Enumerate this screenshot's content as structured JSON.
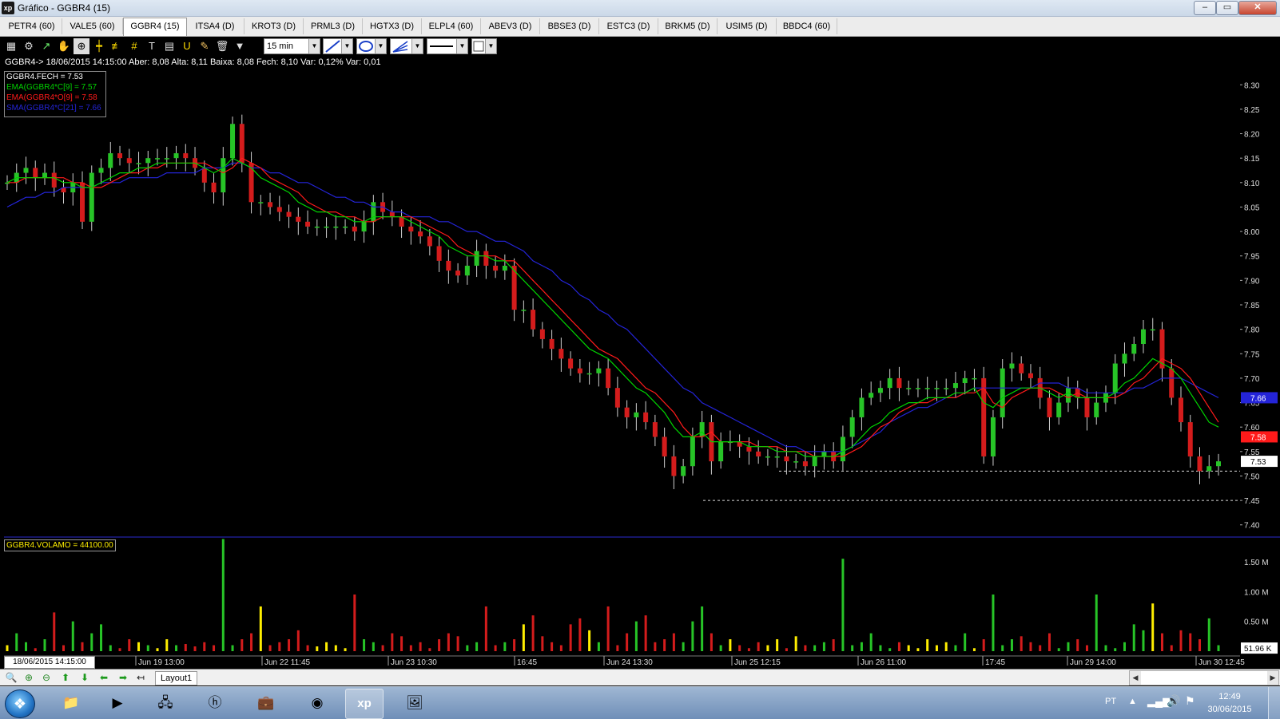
{
  "window": {
    "app_icon": "xp",
    "title": "Gráfico - GGBR4 (15)",
    "controls": [
      "–",
      "▭",
      "✕"
    ]
  },
  "tabs": [
    {
      "label": "PETR4 (60)"
    },
    {
      "label": "VALE5 (60)"
    },
    {
      "label": "GGBR4 (15)",
      "active": true
    },
    {
      "label": "ITSA4 (D)"
    },
    {
      "label": "KROT3 (D)"
    },
    {
      "label": "PRML3 (D)"
    },
    {
      "label": "HGTX3 (D)"
    },
    {
      "label": "ELPL4 (60)"
    },
    {
      "label": "ABEV3 (D)"
    },
    {
      "label": "BBSE3 (D)"
    },
    {
      "label": "ESTC3 (D)"
    },
    {
      "label": "BRKM5 (D)"
    },
    {
      "label": "USIM5 (D)"
    },
    {
      "label": "BBDC4 (60)"
    }
  ],
  "toolbar": {
    "icons": [
      "chart-icon",
      "gear-icon",
      "cursor-icon",
      "hand-icon",
      "zoom-box-icon",
      "crosshair-icon",
      "fibonacci-icon",
      "grid-icon",
      "text-icon",
      "calculator-icon",
      "magnet-icon",
      "brush-icon",
      "trash-icon",
      "filter-icon"
    ],
    "interval": "15 min"
  },
  "chart": {
    "info_line": "GGBR4-> 18/06/2015 14:15:00 Aber: 8,08 Alta: 8,11 Baixa: 8,08 Fech: 8,10 Var: 0,12% Var: 0,01",
    "legend": [
      {
        "label": "GGBR4.FECH = 7.53",
        "color": "#ffffff"
      },
      {
        "label": "EMA(GGBR4*C[9] = 7.57",
        "color": "#00d400"
      },
      {
        "label": "EMA(GGBR4*O[9] = 7.58",
        "color": "#ff1a1a"
      },
      {
        "label": "SMA(GGBR4*C[21] = 7.66",
        "color": "#2424d8"
      }
    ],
    "volume_label": "GGBR4.VOLAMO = 44100.00",
    "cursor_date": "18/06/2015 14:15:00",
    "x_labels": [
      "Jun 19 13:00",
      "Jun 22 11:45",
      "Jun 23 10:30",
      "16:45",
      "Jun 24 13:30",
      "Jun 25 12:15",
      "Jun 26 11:00",
      "17:45",
      "Jun 29 14:00",
      "Jun 30 12:45"
    ],
    "price_ticks": [
      "8.30",
      "8.25",
      "8.20",
      "8.15",
      "8.10",
      "8.05",
      "8.00",
      "7.95",
      "7.90",
      "7.85",
      "7.80",
      "7.75",
      "7.70",
      "7.65",
      "7.60",
      "7.55",
      "7.50",
      "7.45",
      "7.40"
    ],
    "volume_ticks": [
      "1.50 M",
      "1.00 M",
      "0.50 M"
    ],
    "price_tags": [
      {
        "label": "7.66",
        "value": 7.66,
        "color": "#2424d8"
      },
      {
        "label": "7.58",
        "value": 7.58,
        "color": "#ff1a1a"
      },
      {
        "label": "7.53",
        "value": 7.53,
        "color": "#ffffff"
      }
    ],
    "volume_tag": "51.96 K",
    "colors": {
      "up": "#27c427",
      "down": "#d41c1c",
      "ema9_close": "#00d400",
      "ema9_open": "#ff1a1a",
      "sma21": "#2424d8",
      "volume_doji": "#ffee00"
    }
  },
  "chart_data": {
    "type": "candlestick",
    "title": "GGBR4 (15)",
    "ylim": [
      7.38,
      8.32
    ],
    "price_levels": [
      7.51,
      7.45
    ],
    "series": [
      {
        "name": "GGBR4.FECH",
        "values": [
          8.1,
          8.12,
          8.13,
          8.11,
          8.12,
          8.09,
          8.08,
          8.1,
          8.02,
          8.12,
          8.13,
          8.16,
          8.15,
          8.14,
          8.14,
          8.15,
          8.15,
          8.15,
          8.16,
          8.15,
          8.13,
          8.1,
          8.08,
          8.15,
          8.22,
          8.14,
          8.06,
          8.06,
          8.05,
          8.04,
          8.03,
          8.02,
          8.01,
          8.01,
          8.01,
          8.01,
          8.01,
          8.0,
          8.02,
          8.06,
          8.04,
          8.03,
          8.01,
          8.0,
          7.99,
          7.97,
          7.94,
          7.92,
          7.91,
          7.93,
          7.96,
          7.93,
          7.92,
          7.93,
          7.84,
          7.84,
          7.8,
          7.78,
          7.76,
          7.74,
          7.72,
          7.71,
          7.71,
          7.72,
          7.68,
          7.64,
          7.62,
          7.63,
          7.61,
          7.58,
          7.54,
          7.5,
          7.52,
          7.58,
          7.61,
          7.53,
          7.57,
          7.57,
          7.56,
          7.55,
          7.54,
          7.54,
          7.54,
          7.53,
          7.53,
          7.52,
          7.54,
          7.55,
          7.53,
          7.58,
          7.62,
          7.66,
          7.67,
          7.68,
          7.7,
          7.68,
          7.68,
          7.68,
          7.68,
          7.68,
          7.68,
          7.69,
          7.7,
          7.7,
          7.54,
          7.62,
          7.72,
          7.73,
          7.71,
          7.7,
          7.66,
          7.62,
          7.65,
          7.68,
          7.66,
          7.62,
          7.65,
          7.67,
          7.73,
          7.75,
          7.77,
          7.8,
          7.8,
          7.72,
          7.66,
          7.61,
          7.54,
          7.51,
          7.52,
          7.53
        ]
      },
      {
        "name": "EMA(GGBR4*C[9]",
        "values": [
          8.1,
          8.11,
          8.11,
          8.11,
          8.11,
          8.11,
          8.1,
          8.1,
          8.09,
          8.09,
          8.1,
          8.11,
          8.12,
          8.12,
          8.13,
          8.13,
          8.14,
          8.14,
          8.14,
          8.14,
          8.14,
          8.13,
          8.12,
          8.13,
          8.15,
          8.14,
          8.13,
          8.11,
          8.1,
          8.09,
          8.08,
          8.06,
          8.05,
          8.04,
          8.04,
          8.03,
          8.03,
          8.02,
          8.02,
          8.03,
          8.03,
          8.03,
          8.03,
          8.02,
          8.01,
          8.0,
          7.99,
          7.97,
          7.96,
          7.95,
          7.95,
          7.95,
          7.94,
          7.94,
          7.92,
          7.9,
          7.88,
          7.86,
          7.84,
          7.82,
          7.8,
          7.78,
          7.76,
          7.75,
          7.74,
          7.72,
          7.7,
          7.68,
          7.67,
          7.65,
          7.63,
          7.6,
          7.58,
          7.58,
          7.59,
          7.57,
          7.57,
          7.57,
          7.57,
          7.56,
          7.56,
          7.56,
          7.55,
          7.55,
          7.55,
          7.54,
          7.54,
          7.54,
          7.54,
          7.55,
          7.56,
          7.58,
          7.6,
          7.61,
          7.63,
          7.64,
          7.65,
          7.65,
          7.66,
          7.66,
          7.66,
          7.67,
          7.67,
          7.68,
          7.65,
          7.64,
          7.66,
          7.67,
          7.68,
          7.68,
          7.68,
          7.67,
          7.66,
          7.67,
          7.66,
          7.66,
          7.66,
          7.66,
          7.67,
          7.69,
          7.7,
          7.72,
          7.74,
          7.73,
          7.72,
          7.7,
          7.67,
          7.64,
          7.61,
          7.6
        ]
      },
      {
        "name": "EMA(GGBR4*O[9]",
        "values": [
          8.1,
          8.1,
          8.11,
          8.11,
          8.11,
          8.11,
          8.11,
          8.1,
          8.1,
          8.09,
          8.09,
          8.1,
          8.11,
          8.12,
          8.12,
          8.13,
          8.13,
          8.14,
          8.14,
          8.14,
          8.14,
          8.14,
          8.13,
          8.12,
          8.13,
          8.15,
          8.14,
          8.13,
          8.11,
          8.1,
          8.09,
          8.08,
          8.06,
          8.05,
          8.04,
          8.04,
          8.03,
          8.03,
          8.02,
          8.02,
          8.03,
          8.03,
          8.03,
          8.03,
          8.02,
          8.01,
          8.0,
          7.99,
          7.97,
          7.96,
          7.95,
          7.95,
          7.95,
          7.94,
          7.94,
          7.92,
          7.9,
          7.88,
          7.86,
          7.84,
          7.82,
          7.8,
          7.78,
          7.76,
          7.75,
          7.74,
          7.72,
          7.7,
          7.68,
          7.67,
          7.65,
          7.63,
          7.6,
          7.58,
          7.58,
          7.59,
          7.57,
          7.57,
          7.57,
          7.57,
          7.56,
          7.56,
          7.56,
          7.55,
          7.55,
          7.55,
          7.54,
          7.54,
          7.54,
          7.54,
          7.55,
          7.56,
          7.58,
          7.6,
          7.61,
          7.63,
          7.64,
          7.65,
          7.65,
          7.66,
          7.66,
          7.66,
          7.67,
          7.67,
          7.68,
          7.65,
          7.64,
          7.66,
          7.67,
          7.68,
          7.68,
          7.68,
          7.67,
          7.66,
          7.67,
          7.66,
          7.66,
          7.66,
          7.66,
          7.67,
          7.69,
          7.7,
          7.72,
          7.74,
          7.73,
          7.72,
          7.7,
          7.67,
          7.64,
          7.61
        ]
      },
      {
        "name": "SMA(GGBR4*C[21]",
        "values": [
          8.05,
          8.06,
          8.07,
          8.07,
          8.08,
          8.08,
          8.09,
          8.09,
          8.09,
          8.09,
          8.1,
          8.1,
          8.1,
          8.11,
          8.11,
          8.11,
          8.11,
          8.12,
          8.12,
          8.12,
          8.12,
          8.13,
          8.13,
          8.13,
          8.14,
          8.14,
          8.13,
          8.13,
          8.12,
          8.12,
          8.11,
          8.1,
          8.1,
          8.09,
          8.08,
          8.07,
          8.07,
          8.06,
          8.06,
          8.05,
          8.05,
          8.04,
          8.04,
          8.03,
          8.03,
          8.03,
          8.02,
          8.02,
          8.01,
          8.0,
          8.0,
          7.99,
          7.98,
          7.98,
          7.97,
          7.96,
          7.94,
          7.93,
          7.92,
          7.9,
          7.89,
          7.87,
          7.86,
          7.84,
          7.83,
          7.81,
          7.8,
          7.78,
          7.76,
          7.74,
          7.72,
          7.7,
          7.68,
          7.67,
          7.65,
          7.64,
          7.63,
          7.62,
          7.61,
          7.6,
          7.59,
          7.58,
          7.57,
          7.56,
          7.56,
          7.55,
          7.55,
          7.55,
          7.55,
          7.55,
          7.56,
          7.57,
          7.58,
          7.59,
          7.61,
          7.62,
          7.63,
          7.64,
          7.64,
          7.65,
          7.66,
          7.66,
          7.67,
          7.68,
          7.68,
          7.68,
          7.68,
          7.68,
          7.68,
          7.68,
          7.69,
          7.69,
          7.69,
          7.68,
          7.68,
          7.67,
          7.67,
          7.67,
          7.67,
          7.67,
          7.68,
          7.68,
          7.69,
          7.7,
          7.7,
          7.7,
          7.69,
          7.68,
          7.67,
          7.66
        ]
      }
    ],
    "volume_ylim": [
      0,
      1.9
    ],
    "volume_unit": "M",
    "volume": [
      0.1,
      0.3,
      0.15,
      0.05,
      0.2,
      0.65,
      0.1,
      0.5,
      0.15,
      0.3,
      0.45,
      0.1,
      0.05,
      0.2,
      0.15,
      0.1,
      0.05,
      0.2,
      0.1,
      0.12,
      0.08,
      0.15,
      0.1,
      1.88,
      0.1,
      0.2,
      0.3,
      0.75,
      0.1,
      0.15,
      0.2,
      0.35,
      0.1,
      0.08,
      0.15,
      0.1,
      0.05,
      0.95,
      0.2,
      0.15,
      0.1,
      0.3,
      0.25,
      0.1,
      0.15,
      0.05,
      0.2,
      0.3,
      0.25,
      0.1,
      0.15,
      0.75,
      0.1,
      0.15,
      0.2,
      0.45,
      0.6,
      0.25,
      0.15,
      0.1,
      0.45,
      0.55,
      0.35,
      0.15,
      0.75,
      0.1,
      0.3,
      0.5,
      0.6,
      0.15,
      0.2,
      0.3,
      0.15,
      0.5,
      0.75,
      0.3,
      0.1,
      0.2,
      0.1,
      0.05,
      0.15,
      0.1,
      0.2,
      0.05,
      0.25,
      0.1,
      0.1,
      0.15,
      0.2,
      1.55,
      0.1,
      0.15,
      0.3,
      0.1,
      0.05,
      0.15,
      0.1,
      0.05,
      0.2,
      0.1,
      0.15,
      0.1,
      0.3,
      0.05,
      0.2,
      0.95,
      0.1,
      0.2,
      0.25,
      0.15,
      0.1,
      0.3,
      0.05,
      0.15,
      0.2,
      0.1,
      0.95,
      0.1,
      0.05,
      0.15,
      0.45,
      0.35,
      0.8,
      0.3,
      0.1,
      0.35,
      0.3,
      0.2,
      0.55,
      0.1
    ],
    "x_categories": [
      "Jun 19 13:00",
      "Jun 22 11:45",
      "Jun 23 10:30",
      "16:45",
      "Jun 24 13:30",
      "Jun 25 12:15",
      "Jun 26 11:00",
      "17:45",
      "Jun 29 14:00",
      "Jun 30 12:45"
    ]
  },
  "bottom": {
    "nav_icons": [
      "zoom-fit-icon",
      "zoom-in-icon",
      "zoom-out-icon",
      "arrow-up-icon",
      "arrow-down-icon",
      "arrow-left-icon",
      "arrow-right-icon",
      "back-icon"
    ],
    "layout_tab": "Layout1"
  },
  "taskbar": {
    "apps": [
      "explorer-icon",
      "media-player-icon",
      "network-icon",
      "hp-icon",
      "briefcase-icon",
      "chrome-icon",
      "xp-icon",
      "photos-icon"
    ],
    "active_app": "xp",
    "language": "PT",
    "time": "12:49",
    "date": "30/06/2015"
  }
}
